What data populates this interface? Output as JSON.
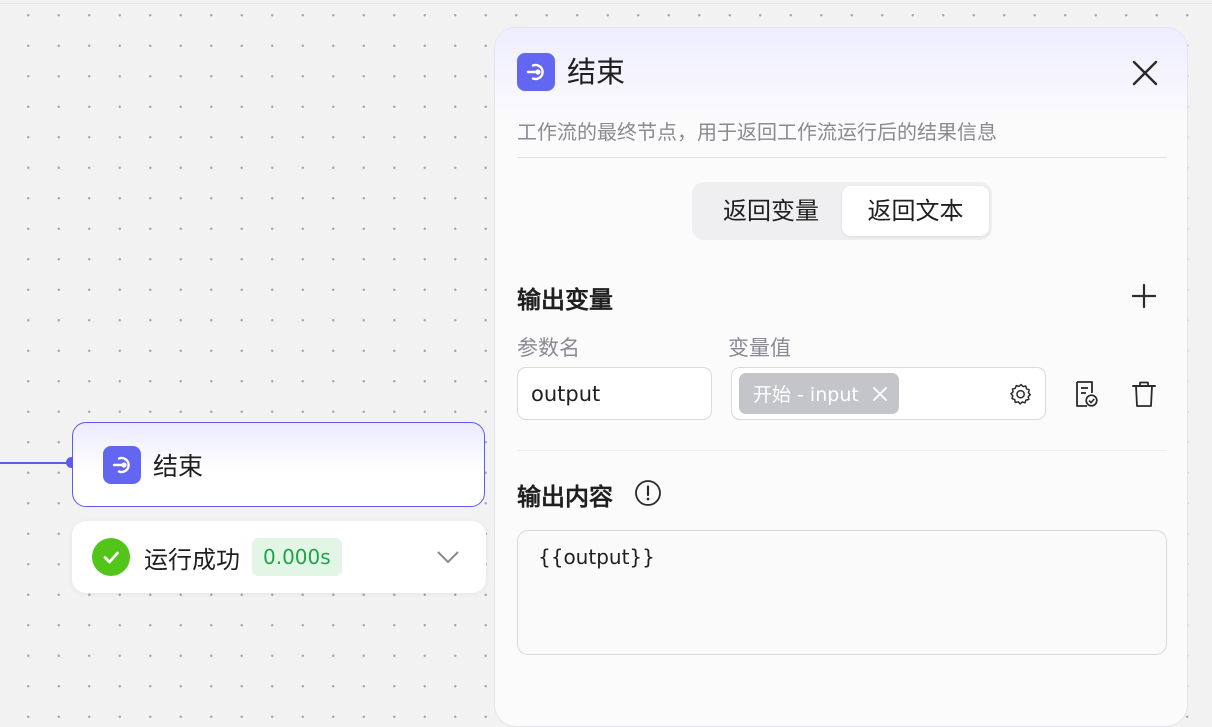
{
  "canvas": {
    "node": {
      "title": "结束",
      "icon": "end-node-icon"
    },
    "run_status": {
      "text": "运行成功",
      "time": "0.000s",
      "icon": "check-circle-icon",
      "color": "#52c41a"
    },
    "accent": "#5b5bf0"
  },
  "panel": {
    "title": "结束",
    "description": "工作流的最终节点，用于返回工作流运行后的结果信息",
    "tabs": [
      {
        "label": "返回变量",
        "active": false
      },
      {
        "label": "返回文本",
        "active": true
      }
    ],
    "output_variables": {
      "title": "输出变量",
      "col_name": "参数名",
      "col_value": "变量值",
      "rows": [
        {
          "name": "output",
          "value_tag": "开始 - input"
        }
      ]
    },
    "output_content": {
      "title": "输出内容",
      "value": "{{output}}"
    }
  }
}
